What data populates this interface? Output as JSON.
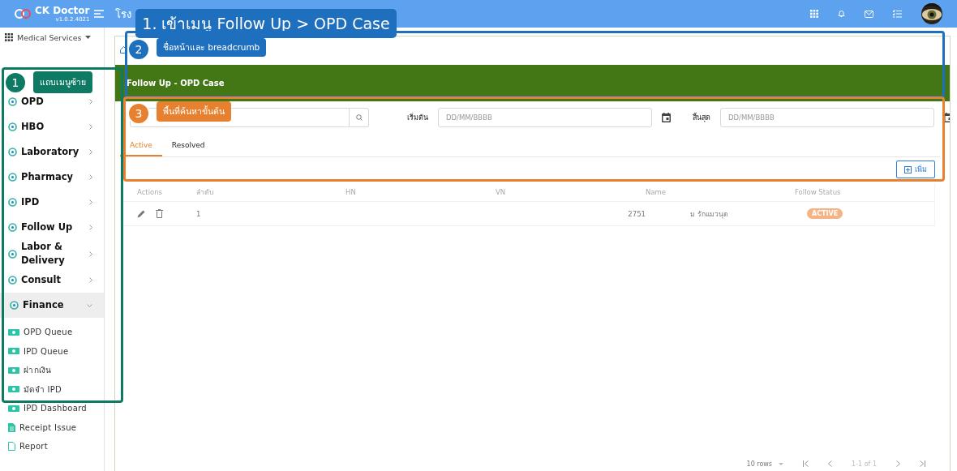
{
  "topbar": {
    "logo": "CK Doctor",
    "version": "v1.0.2.4021",
    "hospital": "โรง"
  },
  "sidebar": {
    "module": "Medical Services",
    "items": [
      {
        "label": "OPD",
        "expanded": false
      },
      {
        "label": "HBO",
        "expanded": false
      },
      {
        "label": "Laboratory",
        "expanded": false
      },
      {
        "label": "Pharmacy",
        "expanded": false
      },
      {
        "label": "IPD",
        "expanded": false
      },
      {
        "label": "Follow Up",
        "expanded": false
      },
      {
        "label": "Labor & Delivery",
        "expanded": false
      },
      {
        "label": "Consult",
        "expanded": false
      },
      {
        "label": "Finance",
        "expanded": true,
        "children": [
          {
            "label": "OPD Queue",
            "kind": "money"
          },
          {
            "label": "IPD Queue",
            "kind": "money"
          },
          {
            "label": "ฝากเงิน",
            "kind": "money"
          },
          {
            "label": "มัดจำ IPD",
            "kind": "money"
          },
          {
            "label": "IPD Dashboard",
            "kind": "money"
          },
          {
            "label": "Receipt Issue",
            "kind": "doc"
          },
          {
            "label": "Report",
            "kind": "file"
          }
        ]
      }
    ]
  },
  "page": {
    "title": "Follow Up - OPD Case",
    "start_label": "เริ่มต้น",
    "start_placeholder": "DD/MM/BBBB",
    "end_label": "สิ้นสุด",
    "end_placeholder": "DD/MM/BBBB",
    "tabs": [
      {
        "label": "Active",
        "selected": true
      },
      {
        "label": "Resolved",
        "selected": false
      }
    ],
    "add_button": "เพิ่ม",
    "table": {
      "columns": [
        "Actions",
        "ลำดับ",
        "HN",
        "VN",
        "Name",
        "Follow Status"
      ],
      "rows": [
        {
          "index": "1",
          "vn": "2751",
          "name": "ม รักแมวนุด",
          "status": "ACTIVE"
        }
      ]
    },
    "pagination": {
      "rows": "10 rows",
      "range": "1-1 of 1"
    }
  },
  "annotations": [
    {
      "kind": "title",
      "label": "1. เข้าเมนู Follow Up > OPD Case"
    },
    {
      "kind": "callout",
      "number": "2",
      "label": "ชื่อหน้าและ breadcrumb",
      "color": "#1f6fbf"
    },
    {
      "kind": "callout",
      "number": "1",
      "label": "แถบเมนูซ้าย",
      "color": "#0f7a63"
    },
    {
      "kind": "callout",
      "number": "3",
      "label": "พื้นที่ค้นหาขั้นต้น",
      "color": "#e8812f"
    }
  ]
}
